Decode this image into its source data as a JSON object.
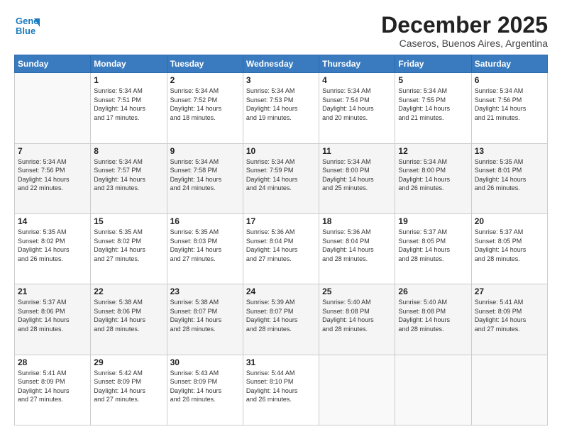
{
  "logo": {
    "line1": "General",
    "line2": "Blue"
  },
  "title": "December 2025",
  "location": "Caseros, Buenos Aires, Argentina",
  "weekdays": [
    "Sunday",
    "Monday",
    "Tuesday",
    "Wednesday",
    "Thursday",
    "Friday",
    "Saturday"
  ],
  "weeks": [
    [
      {
        "day": "",
        "info": ""
      },
      {
        "day": "1",
        "info": "Sunrise: 5:34 AM\nSunset: 7:51 PM\nDaylight: 14 hours\nand 17 minutes."
      },
      {
        "day": "2",
        "info": "Sunrise: 5:34 AM\nSunset: 7:52 PM\nDaylight: 14 hours\nand 18 minutes."
      },
      {
        "day": "3",
        "info": "Sunrise: 5:34 AM\nSunset: 7:53 PM\nDaylight: 14 hours\nand 19 minutes."
      },
      {
        "day": "4",
        "info": "Sunrise: 5:34 AM\nSunset: 7:54 PM\nDaylight: 14 hours\nand 20 minutes."
      },
      {
        "day": "5",
        "info": "Sunrise: 5:34 AM\nSunset: 7:55 PM\nDaylight: 14 hours\nand 21 minutes."
      },
      {
        "day": "6",
        "info": "Sunrise: 5:34 AM\nSunset: 7:56 PM\nDaylight: 14 hours\nand 21 minutes."
      }
    ],
    [
      {
        "day": "7",
        "info": "Sunrise: 5:34 AM\nSunset: 7:56 PM\nDaylight: 14 hours\nand 22 minutes."
      },
      {
        "day": "8",
        "info": "Sunrise: 5:34 AM\nSunset: 7:57 PM\nDaylight: 14 hours\nand 23 minutes."
      },
      {
        "day": "9",
        "info": "Sunrise: 5:34 AM\nSunset: 7:58 PM\nDaylight: 14 hours\nand 24 minutes."
      },
      {
        "day": "10",
        "info": "Sunrise: 5:34 AM\nSunset: 7:59 PM\nDaylight: 14 hours\nand 24 minutes."
      },
      {
        "day": "11",
        "info": "Sunrise: 5:34 AM\nSunset: 8:00 PM\nDaylight: 14 hours\nand 25 minutes."
      },
      {
        "day": "12",
        "info": "Sunrise: 5:34 AM\nSunset: 8:00 PM\nDaylight: 14 hours\nand 26 minutes."
      },
      {
        "day": "13",
        "info": "Sunrise: 5:35 AM\nSunset: 8:01 PM\nDaylight: 14 hours\nand 26 minutes."
      }
    ],
    [
      {
        "day": "14",
        "info": "Sunrise: 5:35 AM\nSunset: 8:02 PM\nDaylight: 14 hours\nand 26 minutes."
      },
      {
        "day": "15",
        "info": "Sunrise: 5:35 AM\nSunset: 8:02 PM\nDaylight: 14 hours\nand 27 minutes."
      },
      {
        "day": "16",
        "info": "Sunrise: 5:35 AM\nSunset: 8:03 PM\nDaylight: 14 hours\nand 27 minutes."
      },
      {
        "day": "17",
        "info": "Sunrise: 5:36 AM\nSunset: 8:04 PM\nDaylight: 14 hours\nand 27 minutes."
      },
      {
        "day": "18",
        "info": "Sunrise: 5:36 AM\nSunset: 8:04 PM\nDaylight: 14 hours\nand 28 minutes."
      },
      {
        "day": "19",
        "info": "Sunrise: 5:37 AM\nSunset: 8:05 PM\nDaylight: 14 hours\nand 28 minutes."
      },
      {
        "day": "20",
        "info": "Sunrise: 5:37 AM\nSunset: 8:05 PM\nDaylight: 14 hours\nand 28 minutes."
      }
    ],
    [
      {
        "day": "21",
        "info": "Sunrise: 5:37 AM\nSunset: 8:06 PM\nDaylight: 14 hours\nand 28 minutes."
      },
      {
        "day": "22",
        "info": "Sunrise: 5:38 AM\nSunset: 8:06 PM\nDaylight: 14 hours\nand 28 minutes."
      },
      {
        "day": "23",
        "info": "Sunrise: 5:38 AM\nSunset: 8:07 PM\nDaylight: 14 hours\nand 28 minutes."
      },
      {
        "day": "24",
        "info": "Sunrise: 5:39 AM\nSunset: 8:07 PM\nDaylight: 14 hours\nand 28 minutes."
      },
      {
        "day": "25",
        "info": "Sunrise: 5:40 AM\nSunset: 8:08 PM\nDaylight: 14 hours\nand 28 minutes."
      },
      {
        "day": "26",
        "info": "Sunrise: 5:40 AM\nSunset: 8:08 PM\nDaylight: 14 hours\nand 28 minutes."
      },
      {
        "day": "27",
        "info": "Sunrise: 5:41 AM\nSunset: 8:09 PM\nDaylight: 14 hours\nand 27 minutes."
      }
    ],
    [
      {
        "day": "28",
        "info": "Sunrise: 5:41 AM\nSunset: 8:09 PM\nDaylight: 14 hours\nand 27 minutes."
      },
      {
        "day": "29",
        "info": "Sunrise: 5:42 AM\nSunset: 8:09 PM\nDaylight: 14 hours\nand 27 minutes."
      },
      {
        "day": "30",
        "info": "Sunrise: 5:43 AM\nSunset: 8:09 PM\nDaylight: 14 hours\nand 26 minutes."
      },
      {
        "day": "31",
        "info": "Sunrise: 5:44 AM\nSunset: 8:10 PM\nDaylight: 14 hours\nand 26 minutes."
      },
      {
        "day": "",
        "info": ""
      },
      {
        "day": "",
        "info": ""
      },
      {
        "day": "",
        "info": ""
      }
    ]
  ]
}
